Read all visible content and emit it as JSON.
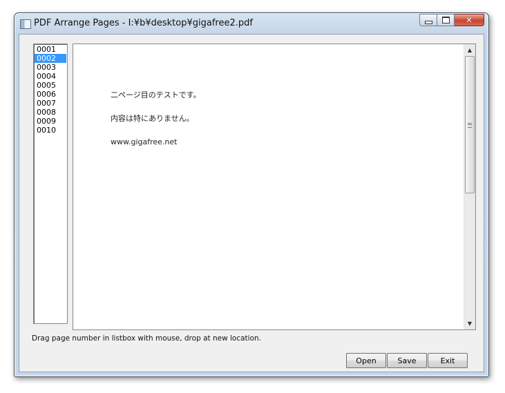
{
  "window": {
    "title": "PDF Arrange Pages - I:¥b¥desktop¥gigafree2.pdf",
    "close_glyph": "✕"
  },
  "listbox": {
    "items": [
      "0001",
      "0002",
      "0003",
      "0004",
      "0005",
      "0006",
      "0007",
      "0008",
      "0009",
      "0010"
    ],
    "selected_index": 1
  },
  "preview": {
    "lines": [
      "二ページ目のテストです。",
      "内容は特にありません。",
      "www.gigafree.net"
    ],
    "scroll_up_glyph": "▲",
    "scroll_down_glyph": "▼"
  },
  "status": {
    "text": "Drag page number in listbox with mouse, drop at new location."
  },
  "buttons": {
    "open": "Open",
    "save": "Save",
    "exit": "Exit"
  },
  "icons": [
    "app-icon",
    "minimize-icon",
    "maximize-icon",
    "close-icon",
    "scroll-up-icon",
    "scroll-down-icon",
    "scroll-grip-icon"
  ]
}
